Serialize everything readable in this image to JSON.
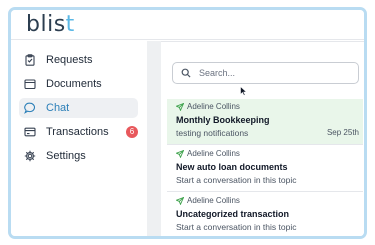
{
  "app": {
    "logo_main": "blis",
    "logo_accent": "t"
  },
  "sidebar": {
    "items": [
      {
        "label": "Requests",
        "icon": "clipboard-icon"
      },
      {
        "label": "Documents",
        "icon": "folder-icon"
      },
      {
        "label": "Chat",
        "icon": "chat-bubble-icon",
        "active": true
      },
      {
        "label": "Transactions",
        "icon": "card-icon",
        "badge": "6"
      },
      {
        "label": "Settings",
        "icon": "gear-icon"
      }
    ]
  },
  "search": {
    "placeholder": "Search..."
  },
  "conversations": [
    {
      "sender": "Adeline Collins",
      "title": "Monthly Bookkeeping",
      "preview": "testing notifications",
      "date": "Sep 25th",
      "selected": true
    },
    {
      "sender": "Adeline Collins",
      "title": "New auto loan documents",
      "preview": "Start a conversation in this topic",
      "date": ""
    },
    {
      "sender": "Adeline Collins",
      "title": "Uncategorized transaction",
      "preview": "Start a conversation in this topic",
      "date": ""
    }
  ],
  "colors": {
    "accent": "#2b7fb8",
    "logo_accent": "#5bb8e6",
    "badge": "#e8585c",
    "selected_row": "#e9f6ea",
    "frame_border": "#b9dcf2"
  }
}
